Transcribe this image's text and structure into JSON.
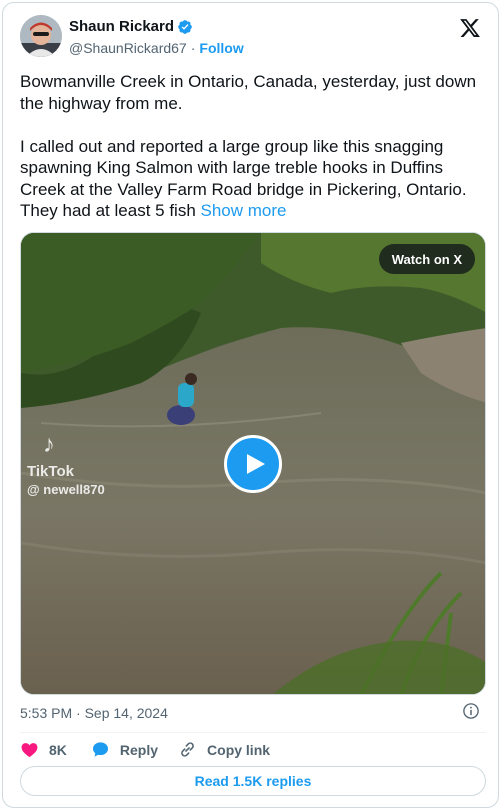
{
  "author": {
    "display_name": "Shaun Rickard",
    "handle": "@ShaunRickard67",
    "separator": "·",
    "follow_label": "Follow"
  },
  "tweet": {
    "text": "Bowmanville Creek in Ontario, Canada, yesterday, just down the highway from me.\n\nI called out and reported a large group like this snagging spawning King Salmon with large treble hooks in Duffins Creek at the Valley Farm Road bridge in Pickering, Ontario. They had at least 5 fish ",
    "show_more_label": "Show more"
  },
  "media": {
    "watch_label": "Watch on X",
    "watermark_brand": "TikTok",
    "watermark_user": "@ newell870"
  },
  "meta": {
    "timestamp": "5:53 PM · Sep 14, 2024"
  },
  "actions": {
    "likes_count": "8K",
    "reply_label": "Reply",
    "copy_link_label": "Copy link"
  },
  "read_replies_label": "Read 1.5K replies",
  "colors": {
    "accent": "#1d9bf0",
    "like": "#f91880",
    "text_secondary": "#536471"
  },
  "icons": [
    "verified-badge-icon",
    "x-logo-icon",
    "play-icon",
    "info-icon",
    "heart-icon",
    "reply-bubble-icon",
    "link-icon",
    "tiktok-note-icon"
  ]
}
